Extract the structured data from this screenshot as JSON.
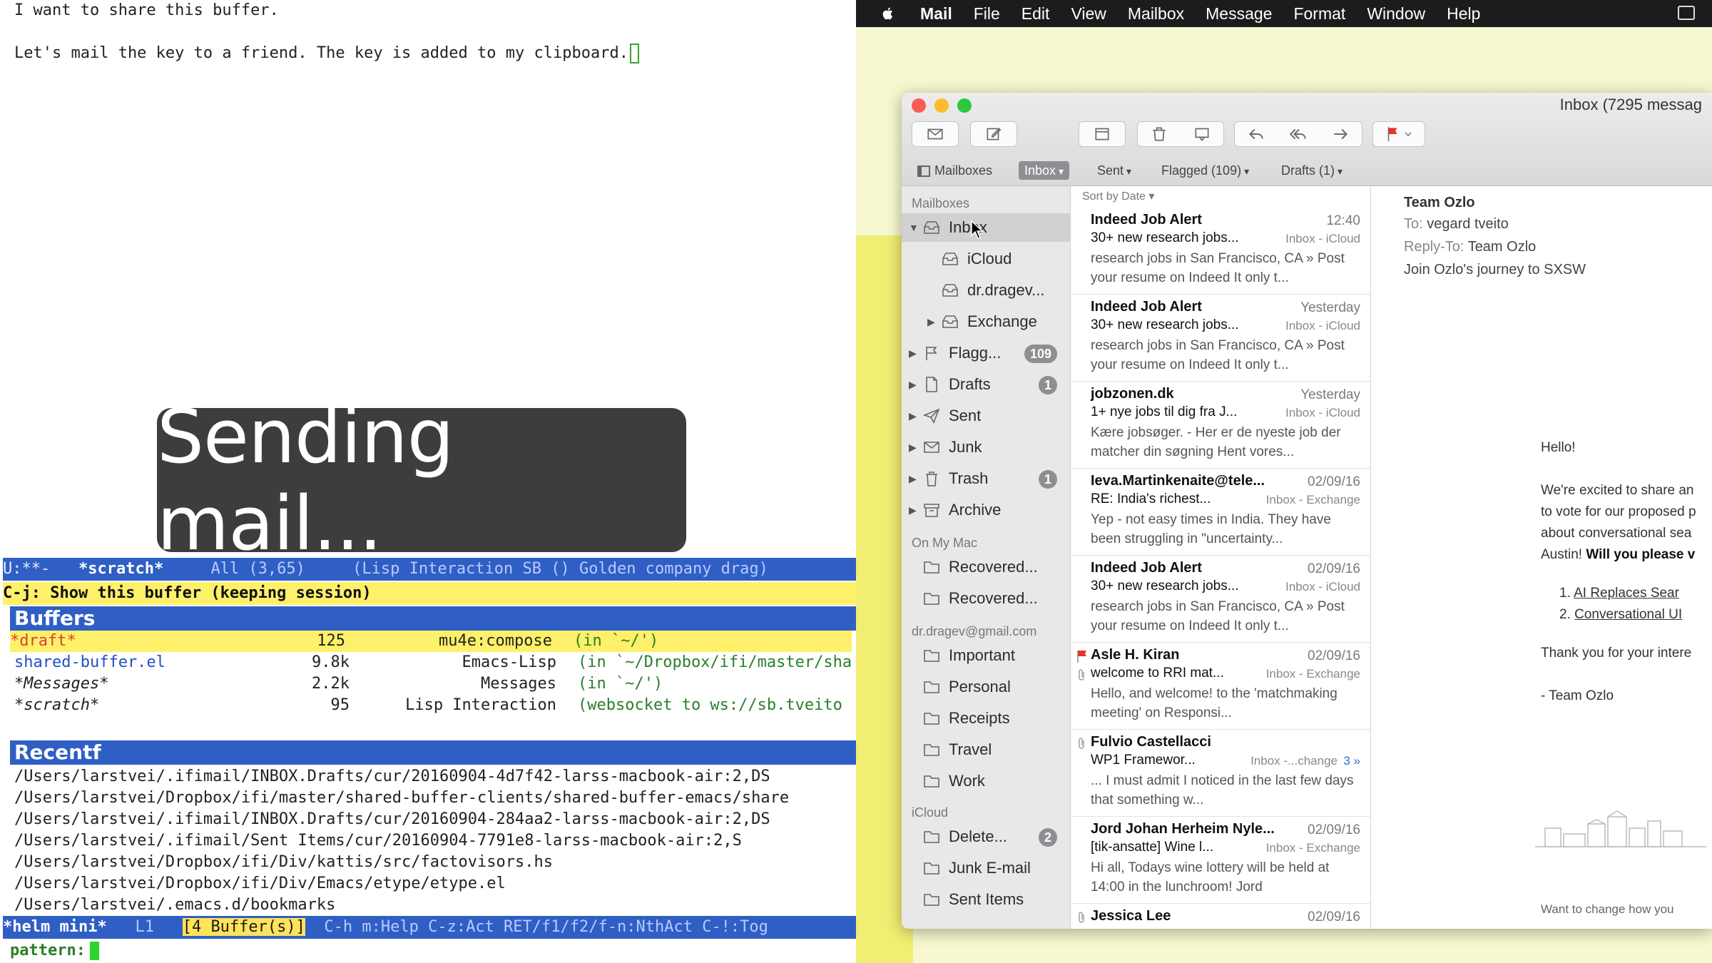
{
  "emacs": {
    "line1": "I want to share this buffer.",
    "line2": "Let's mail the key to a friend. The key is added to my clipboard.",
    "overlay_text": "Sending mail...",
    "modeline": {
      "status": "U:**-",
      "buffer": "*scratch*",
      "position": "All (3,65)",
      "modes": "(Lisp Interaction SB () Golden company drag)"
    },
    "help_line": "C-j: Show this buffer (keeping session)",
    "buffers_header": "Buffers",
    "buffers": [
      {
        "name": "*draft*",
        "size": "125",
        "mode": "mu4e:compose",
        "dir": "(in `~/')"
      },
      {
        "name": "shared-buffer.el",
        "size": "9.8k",
        "mode": "Emacs-Lisp",
        "dir": "(in `~/Dropbox/ifi/master/sha"
      },
      {
        "name": "*Messages*",
        "size": "2.2k",
        "mode": "Messages",
        "dir": "(in `~/')"
      },
      {
        "name": "*scratch*",
        "size": "95",
        "mode": "Lisp Interaction",
        "dir": "(websocket to ws://sb.tveito"
      }
    ],
    "recentf_header": "Recentf",
    "recentf": [
      "/Users/larstvei/.ifimail/INBOX.Drafts/cur/20160904-4d7f42-larss-macbook-air:2,DS",
      "/Users/larstvei/Dropbox/ifi/master/shared-buffer-clients/shared-buffer-emacs/share",
      "/Users/larstvei/.ifimail/INBOX.Drafts/cur/20160904-284aa2-larss-macbook-air:2,DS",
      "/Users/larstvei/.ifimail/Sent Items/cur/20160904-7791e8-larss-macbook-air:2,S",
      "/Users/larstvei/Dropbox/ifi/Div/kattis/src/factovisors.hs",
      "/Users/larstvei/Dropbox/ifi/Div/Emacs/etype/etype.el",
      "/Users/larstvei/.emacs.d/bookmarks"
    ],
    "helm_modeline": {
      "name": "*helm mini*",
      "line": "L1",
      "count": "[4 Buffer(s)]",
      "keys": "C-h m:Help C-z:Act RET/f1/f2/f-n:NthAct C-!:Tog"
    },
    "minibuffer_prompt": "pattern:"
  },
  "menubar": {
    "app": "Mail",
    "items": [
      "File",
      "Edit",
      "View",
      "Mailbox",
      "Message",
      "Format",
      "Window",
      "Help"
    ]
  },
  "mail": {
    "window_title": "Inbox (7295 messag",
    "favorites": [
      {
        "label": "Mailboxes"
      },
      {
        "label": "Inbox"
      },
      {
        "label": "Sent"
      },
      {
        "label": "Flagged (109)"
      },
      {
        "label": "Drafts (1)"
      }
    ],
    "sidebar": {
      "mailboxes_header": "Mailboxes",
      "items": [
        {
          "label": "Inbox"
        },
        {
          "label": "iCloud"
        },
        {
          "label": "dr.dragev..."
        },
        {
          "label": "Exchange"
        },
        {
          "label": "Flagg...",
          "badge": "109"
        },
        {
          "label": "Drafts",
          "badge": "1"
        },
        {
          "label": "Sent"
        },
        {
          "label": "Junk"
        },
        {
          "label": "Trash",
          "badge": "1"
        },
        {
          "label": "Archive"
        }
      ],
      "onmymac_header": "On My Mac",
      "onmymac": [
        {
          "label": "Recovered..."
        },
        {
          "label": "Recovered..."
        }
      ],
      "gmail_header": "dr.dragev@gmail.com",
      "gmail": [
        {
          "label": "Important"
        },
        {
          "label": "Personal"
        },
        {
          "label": "Receipts"
        },
        {
          "label": "Travel"
        },
        {
          "label": "Work"
        }
      ],
      "icloud_header": "iCloud",
      "icloud": [
        {
          "label": "Delete...",
          "badge": "2"
        },
        {
          "label": "Junk E-mail"
        },
        {
          "label": "Sent Items"
        }
      ]
    },
    "sort_by": "Sort by Date",
    "messages": [
      {
        "from": "Indeed Job Alert",
        "date": "12:40",
        "subject": "30+ new research jobs...",
        "mailbox": "Inbox - iCloud",
        "preview": "research jobs in San Francisco, CA » Post your resume on Indeed It only t..."
      },
      {
        "from": "Indeed Job Alert",
        "date": "Yesterday",
        "subject": "30+ new research jobs...",
        "mailbox": "Inbox - iCloud",
        "preview": "research jobs in San Francisco, CA » Post your resume on Indeed It only t..."
      },
      {
        "from": "jobzonen.dk",
        "date": "Yesterday",
        "subject": "1+ nye jobs til dig fra J...",
        "mailbox": "Inbox - iCloud",
        "preview": "Kære jobsøger. - Her er de nyeste job der matcher din søgning Hent vores..."
      },
      {
        "from": "Ieva.Martinkenaite@tele...",
        "date": "02/09/16",
        "subject": "RE: India's richest...",
        "mailbox": "Inbox - Exchange",
        "preview": "Yep - not easy times in India. They have been struggling in \"uncertainty..."
      },
      {
        "from": "Indeed Job Alert",
        "date": "02/09/16",
        "subject": "30+ new research jobs...",
        "mailbox": "Inbox - iCloud",
        "preview": "research jobs in San Francisco, CA » Post your resume on Indeed It only t..."
      },
      {
        "from": "Asle H. Kiran",
        "date": "02/09/16",
        "subject": "welcome to RRI mat...",
        "mailbox": "Inbox - Exchange",
        "preview": "Hello, and welcome! to the 'matchmaking meeting' on Responsi..."
      },
      {
        "from": "Fulvio Castellacci",
        "date": "02/09/16",
        "subject": "WP1 Framewor...",
        "mailbox": "Inbox -...change",
        "thread": "3 »",
        "preview": "... I must admit I noticed in the last few days that something w..."
      },
      {
        "from": "Jord Johan Herheim Nyle...",
        "date": "02/09/16",
        "subject": "[tik-ansatte] Wine l...",
        "mailbox": "Inbox - Exchange",
        "preview": "Hi all, Todays wine lottery will be held at 14:00 in the lunchroom! Jord"
      },
      {
        "from": "Jessica Lee",
        "date": "02/09/16",
        "subject": "",
        "mailbox": "",
        "preview": ""
      }
    ],
    "reader": {
      "from": "Team Ozlo",
      "to_label": "To:",
      "to": "vegard tveito",
      "replyto_label": "Reply-To:",
      "replyto": "Team Ozlo",
      "subject": "Join Ozlo's journey to SXSW",
      "hello": "Hello!",
      "p1a": "We're excited to share an",
      "p1b": "to vote for our proposed p",
      "p1c": "about conversational sea",
      "p1d_plain": "Austin! ",
      "p1d_bold": "Will you please v",
      "li1_num": "1.",
      "li1": "AI Replaces Sear",
      "li2_num": "2.",
      "li2": "Conversational UI",
      "thanks": "Thank you for your intere",
      "sign": "- Team Ozlo",
      "footer": "Want to change how you"
    }
  }
}
